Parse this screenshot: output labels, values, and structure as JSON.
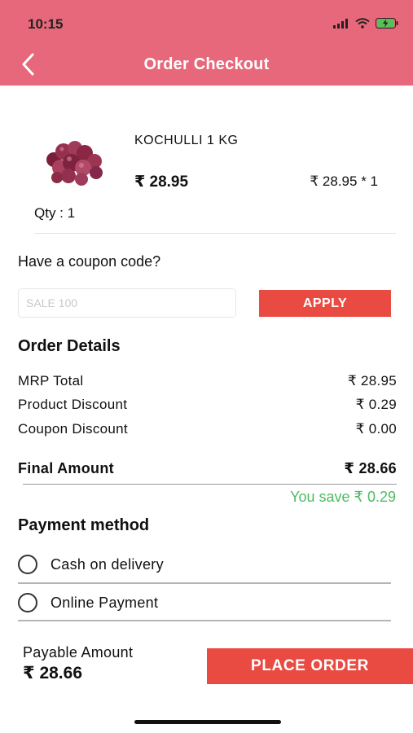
{
  "status_bar": {
    "time": "10:15"
  },
  "header": {
    "title": "Order Checkout"
  },
  "product": {
    "name": "KOCHULLI  1 KG",
    "price": "₹ 28.95",
    "unit_price_qty": "₹ 28.95 * 1",
    "qty": "Qty : 1"
  },
  "coupon": {
    "question": "Have a coupon code?",
    "placeholder": "SALE 100",
    "apply_label": "APPLY"
  },
  "order_details": {
    "title": "Order Details",
    "rows": [
      {
        "label": "MRP Total",
        "value": "₹ 28.95"
      },
      {
        "label": "Product Discount",
        "value": "₹ 0.29"
      },
      {
        "label": "Coupon Discount",
        "value": "₹ 0.00"
      }
    ],
    "final": {
      "label": "Final Amount",
      "value": "₹ 28.66"
    },
    "savings": "You save ₹ 0.29"
  },
  "payment": {
    "title": "Payment method",
    "options": [
      {
        "label": "Cash on delivery",
        "selected": false
      },
      {
        "label": "Online Payment",
        "selected": false
      }
    ]
  },
  "footer": {
    "payable_label": "Payable Amount",
    "payable_amount": "₹ 28.66",
    "place_order_label": "PLACE ORDER"
  },
  "colors": {
    "header_bg": "#e6687a",
    "button_bg": "#e94b43",
    "savings_text": "#4cbc63"
  }
}
